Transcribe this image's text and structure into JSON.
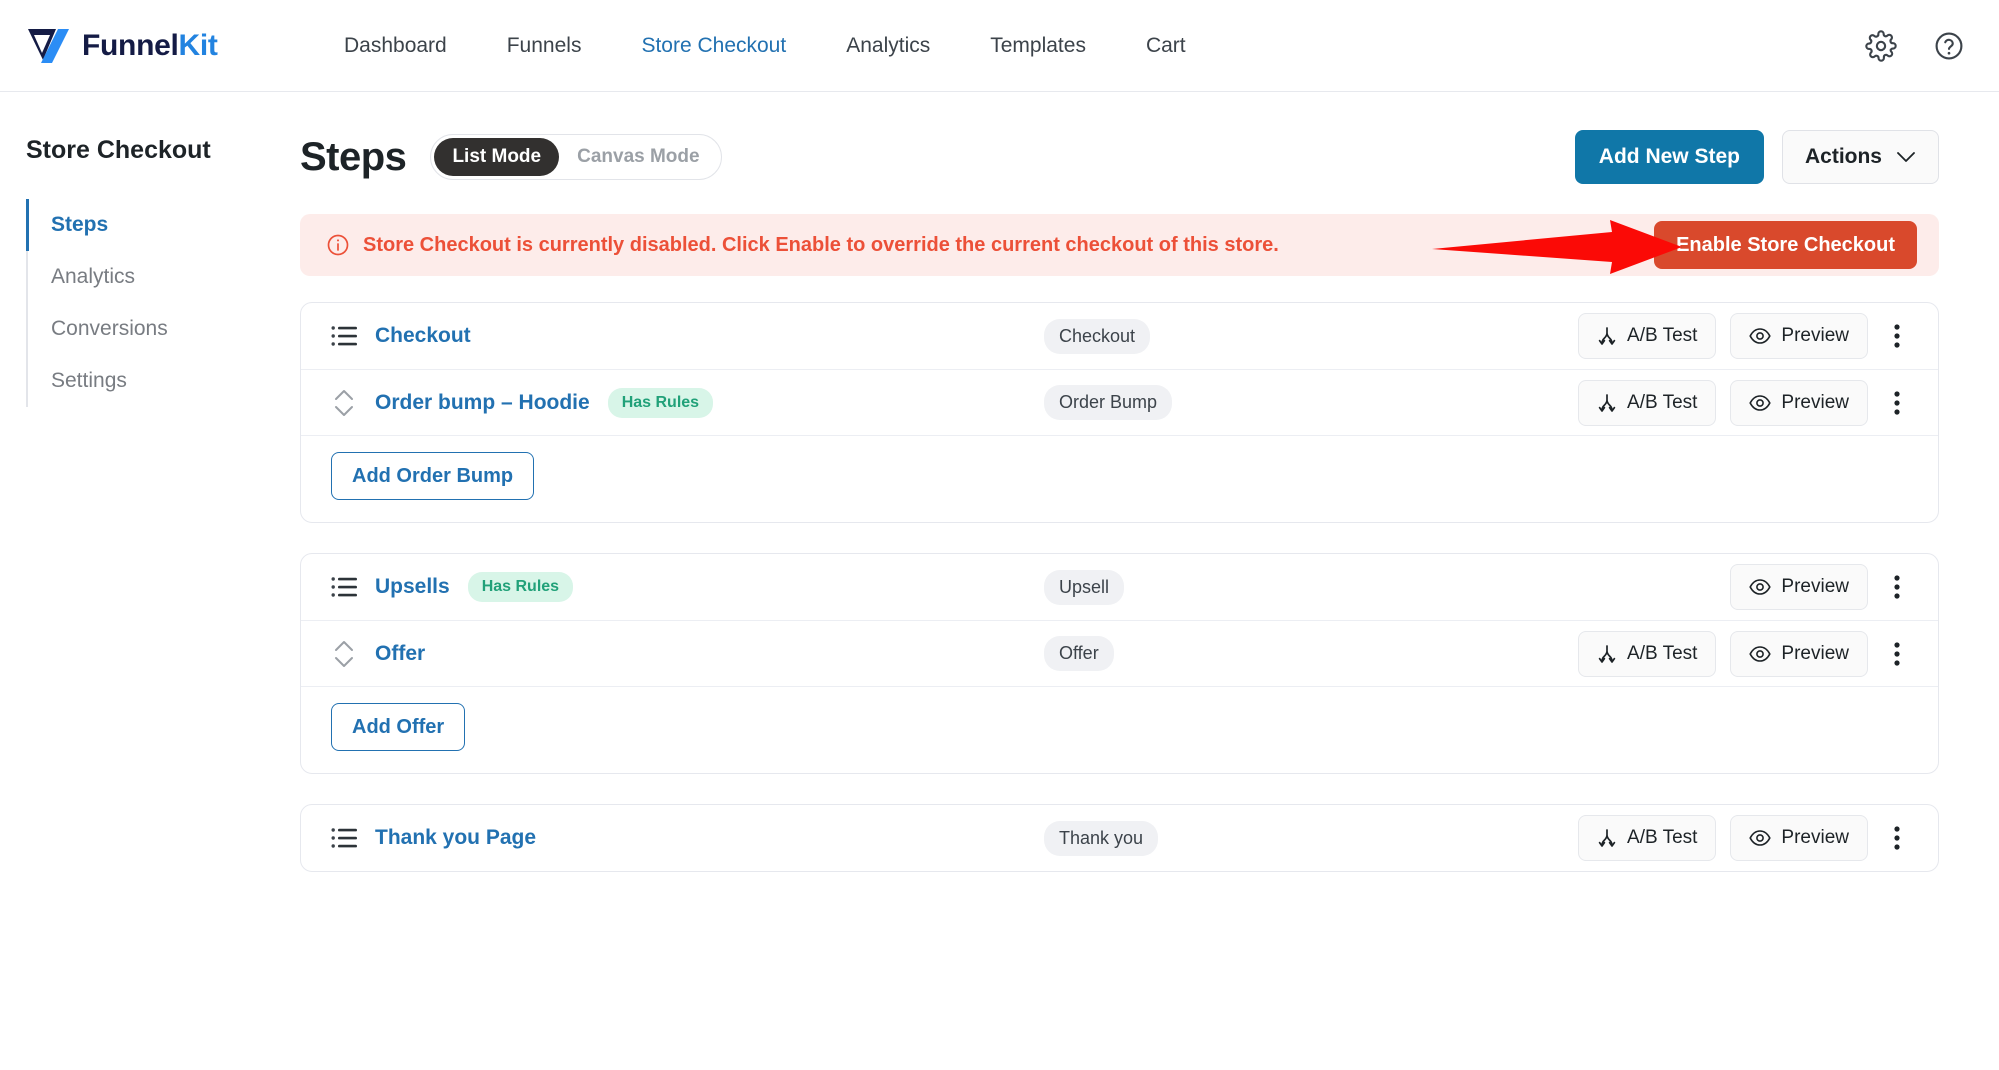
{
  "brand": {
    "name_part1": "Funnel",
    "name_part2": "Kit",
    "logo_icon": "funnelkit-logo-icon"
  },
  "topnav": {
    "items": [
      {
        "label": "Dashboard",
        "active": false
      },
      {
        "label": "Funnels",
        "active": false
      },
      {
        "label": "Store Checkout",
        "active": true
      },
      {
        "label": "Analytics",
        "active": false
      },
      {
        "label": "Templates",
        "active": false
      },
      {
        "label": "Cart",
        "active": false
      }
    ],
    "settings_icon": "gear-icon",
    "help_icon": "help-circle-icon"
  },
  "sidebar": {
    "title": "Store Checkout",
    "items": [
      {
        "label": "Steps",
        "active": true
      },
      {
        "label": "Analytics",
        "active": false
      },
      {
        "label": "Conversions",
        "active": false
      },
      {
        "label": "Settings",
        "active": false
      }
    ]
  },
  "header": {
    "title": "Steps",
    "mode_toggle": {
      "list": "List Mode",
      "canvas": "Canvas Mode",
      "selected": "List Mode"
    },
    "add_step_label": "Add New Step",
    "actions_label": "Actions"
  },
  "notice": {
    "icon": "info-circle-icon",
    "message": "Store Checkout is currently disabled. Click Enable to override the current checkout of this store.",
    "button_label": "Enable Store Checkout",
    "annotation": "red-arrow-pointing-right"
  },
  "common": {
    "ab_test_label": "A/B Test",
    "preview_label": "Preview",
    "has_rules_label": "Has Rules",
    "kebab_label": "More options"
  },
  "colors": {
    "accent_blue": "#2271b1",
    "primary_button": "#1077a8",
    "danger": "#d9492c",
    "notice_bg": "#fdecea",
    "notice_text": "#ec5038",
    "rules_badge_text": "#21a179",
    "rules_badge_bg": "#d8f5e8",
    "arrow": "#fb0a06"
  },
  "cards": [
    {
      "rows": [
        {
          "name": "Checkout",
          "icon": "list-icon",
          "has_rules": false,
          "type_badge": "Checkout",
          "ab_test": true,
          "preview": true,
          "sub": false
        },
        {
          "name": "Order bump – Hoodie",
          "icon": "reorder-icon",
          "has_rules": true,
          "type_badge": "Order Bump",
          "ab_test": true,
          "preview": true,
          "sub": true
        }
      ],
      "footer_button": "Add Order Bump"
    },
    {
      "rows": [
        {
          "name": "Upsells",
          "icon": "list-icon",
          "has_rules": true,
          "type_badge": "Upsell",
          "ab_test": false,
          "preview": true,
          "sub": false
        },
        {
          "name": "Offer",
          "icon": "reorder-icon",
          "has_rules": false,
          "type_badge": "Offer",
          "ab_test": true,
          "preview": true,
          "sub": true
        }
      ],
      "footer_button": "Add Offer"
    },
    {
      "rows": [
        {
          "name": "Thank you Page",
          "icon": "list-icon",
          "has_rules": false,
          "type_badge": "Thank you",
          "ab_test": true,
          "preview": true,
          "sub": false
        }
      ],
      "footer_button": null
    }
  ]
}
